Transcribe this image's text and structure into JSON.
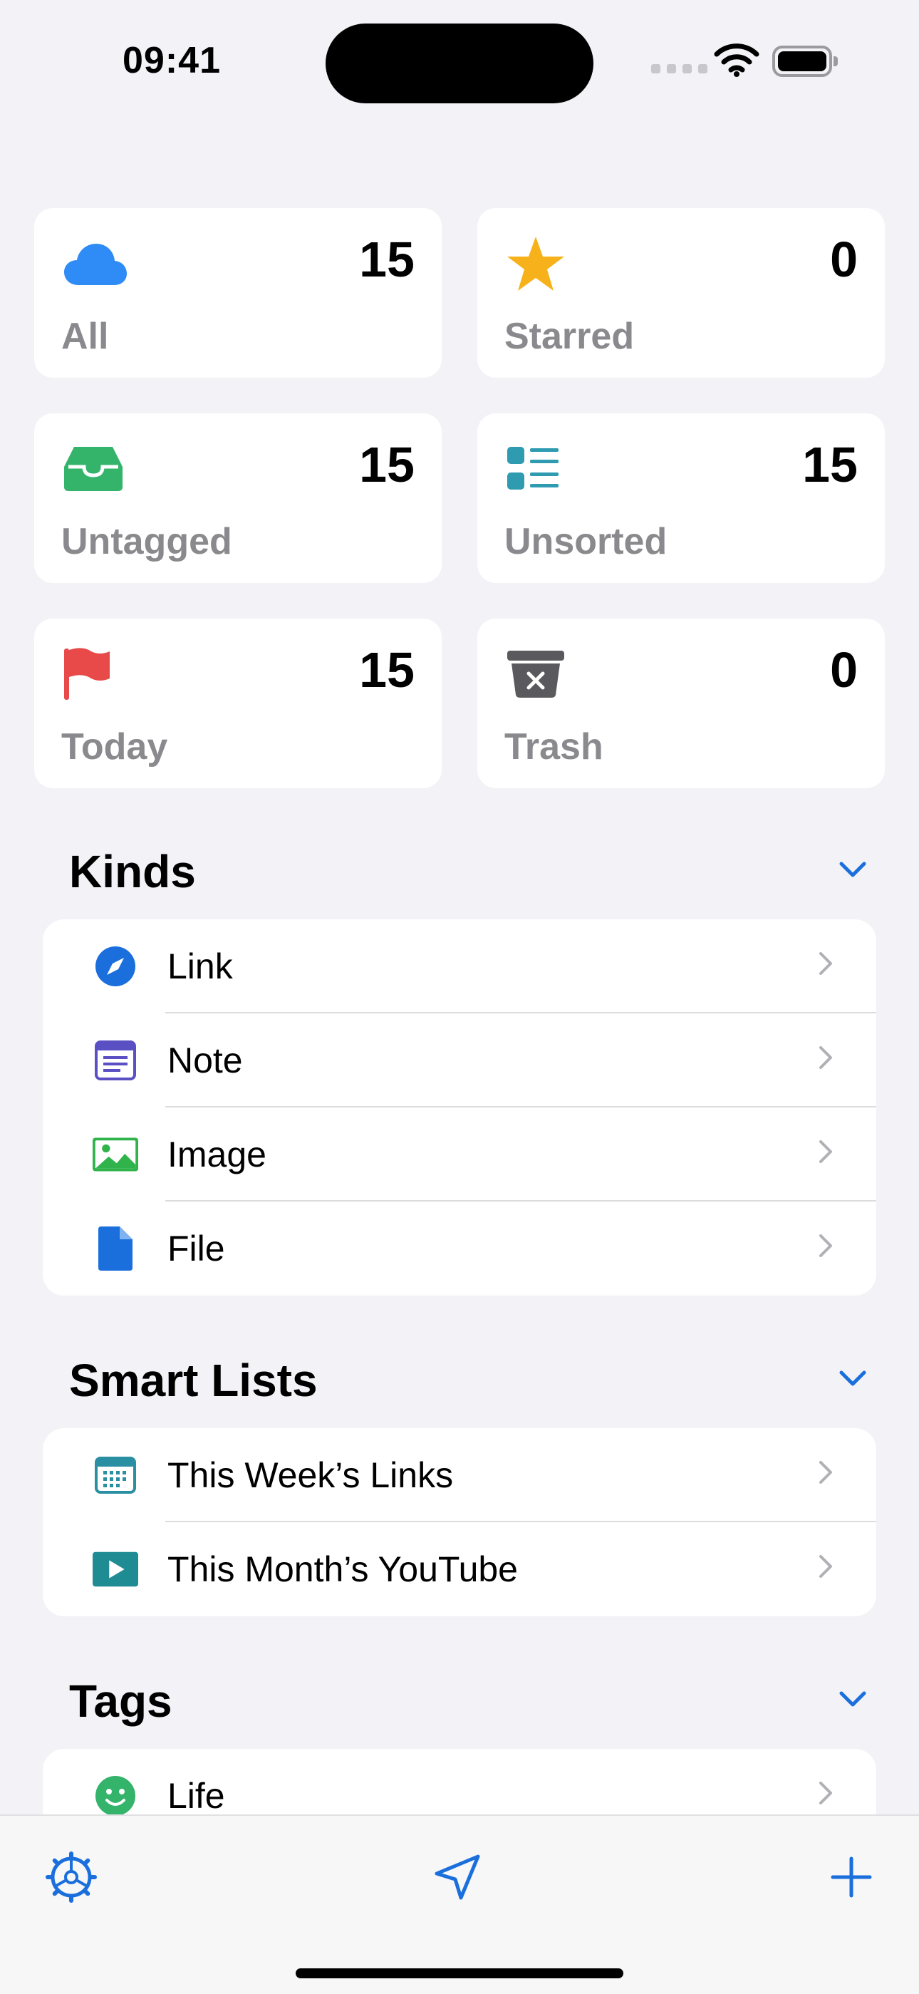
{
  "status": {
    "time": "09:41"
  },
  "cards": [
    {
      "id": "all",
      "label": "All",
      "count": "15",
      "icon": "cloud-icon",
      "color": "#2f8cf6"
    },
    {
      "id": "starred",
      "label": "Starred",
      "count": "0",
      "icon": "star-icon",
      "color": "#f7b21b"
    },
    {
      "id": "untagged",
      "label": "Untagged",
      "count": "15",
      "icon": "tray-icon",
      "color": "#34b36b"
    },
    {
      "id": "unsorted",
      "label": "Unsorted",
      "count": "15",
      "icon": "list-icon",
      "color": "#2e9bb0"
    },
    {
      "id": "today",
      "label": "Today",
      "count": "15",
      "icon": "flag-icon",
      "color": "#e84a4a"
    },
    {
      "id": "trash",
      "label": "Trash",
      "count": "0",
      "icon": "trash-icon",
      "color": "#5a5a5e"
    }
  ],
  "kinds": {
    "title": "Kinds",
    "items": [
      {
        "label": "Link",
        "icon": "compass-icon"
      },
      {
        "label": "Note",
        "icon": "note-icon"
      },
      {
        "label": "Image",
        "icon": "image-icon"
      },
      {
        "label": "File",
        "icon": "file-icon"
      }
    ]
  },
  "smart_lists": {
    "title": "Smart Lists",
    "items": [
      {
        "label": "This Week’s Links",
        "icon": "calendar-icon"
      },
      {
        "label": "This Month’s YouTube",
        "icon": "play-icon"
      }
    ]
  },
  "tags": {
    "title": "Tags",
    "items": [
      {
        "label": "Life",
        "icon": "smiley-icon"
      }
    ]
  },
  "colors": {
    "accent": "#1a6fdc",
    "background": "#f2f2f7"
  }
}
